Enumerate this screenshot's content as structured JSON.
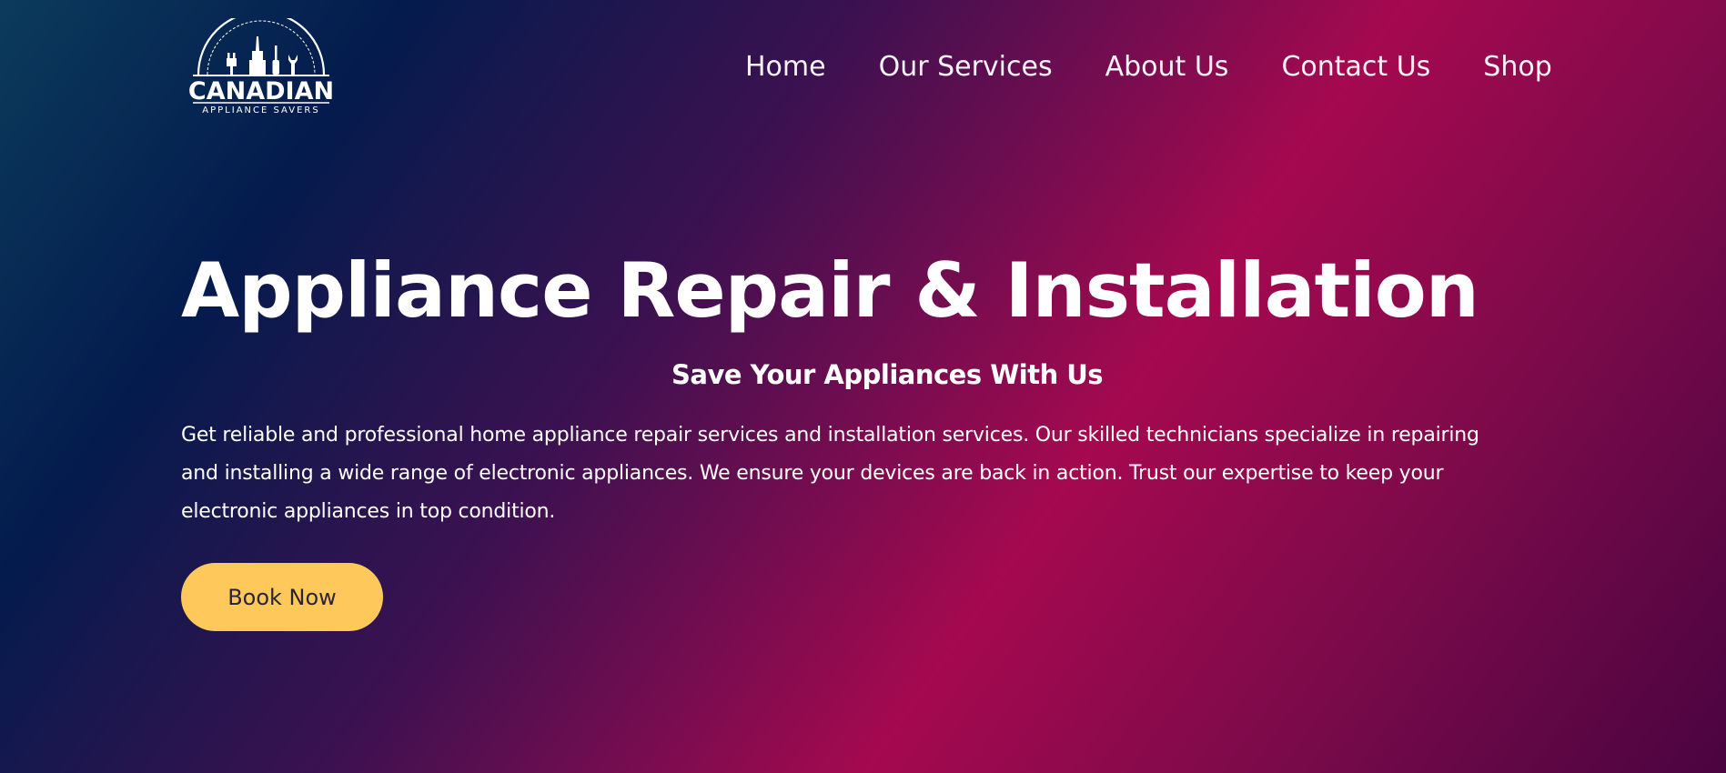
{
  "brand": {
    "name": "CANADIAN",
    "tagline": "APPLIANCE SAVERS"
  },
  "nav": {
    "items": [
      "Home",
      "Our Services",
      "About Us",
      "Contact Us",
      "Shop"
    ]
  },
  "hero": {
    "title": "Appliance Repair & Installation",
    "subtitle": "Save Your Appliances With Us",
    "description": "Get reliable and professional home appliance repair services and installation services. Our skilled technicians specialize in repairing and installing a wide range of electronic appliances. We ensure your devices are back in action. Trust our expertise to keep your electronic appliances in top condition.",
    "cta_label": "Book Now"
  },
  "colors": {
    "cta_bg": "#fec95a",
    "cta_text": "#2b2438",
    "text": "#ffffff"
  }
}
